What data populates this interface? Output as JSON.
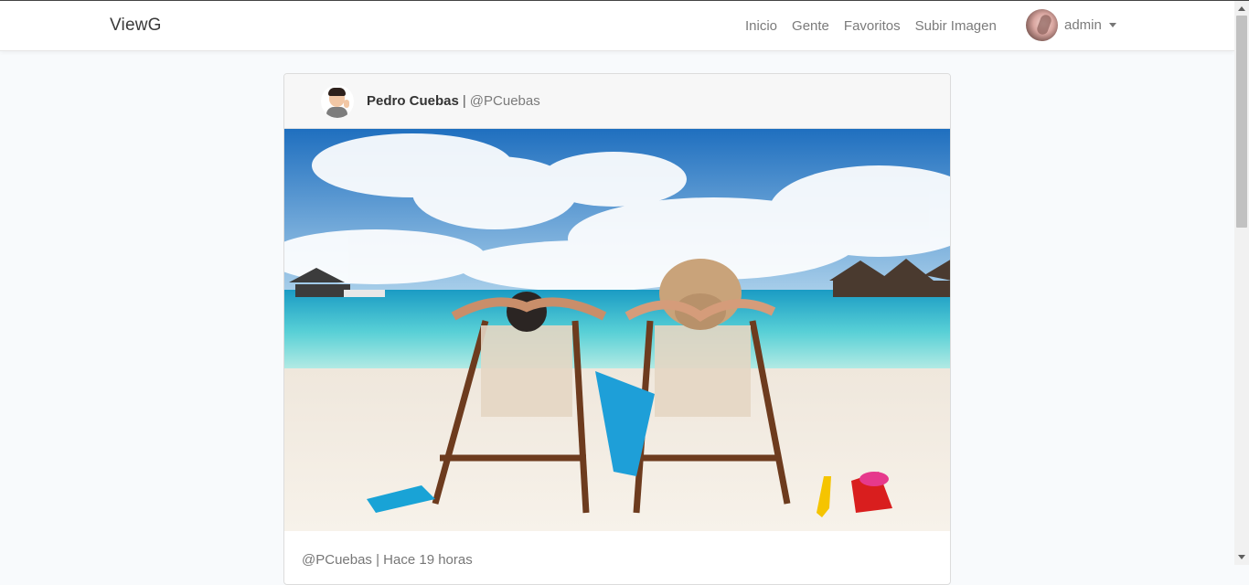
{
  "navbar": {
    "brand": "ViewG",
    "links": [
      "Inicio",
      "Gente",
      "Favoritos",
      "Subir Imagen"
    ],
    "user": "admin"
  },
  "post": {
    "author_name": "Pedro Cuebas",
    "separator": "|",
    "author_nick": "@PCuebas",
    "footer_meta": "@PCuebas | Hace 19 horas",
    "image": {
      "sky": "#2f7fc6",
      "sea": "#5fd3d8",
      "sand": "#f3ece2"
    }
  },
  "colors": {
    "nav_text": "#7b7b7b",
    "page_bg": "#f8fafc",
    "card_header_bg": "#f7f7f7"
  }
}
